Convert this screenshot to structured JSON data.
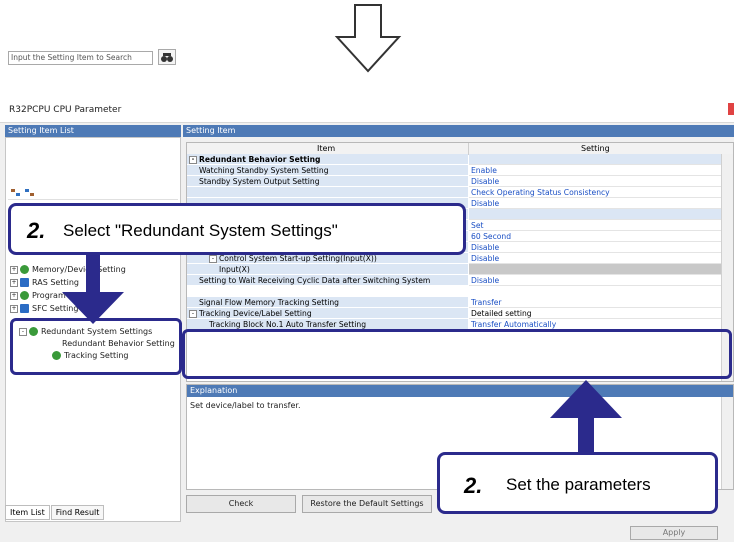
{
  "window": {
    "title": "R32PCPU CPU Parameter"
  },
  "left_panel": {
    "header": "Setting Item List",
    "search_placeholder": "Input the Setting Item to Search",
    "tree": [
      {
        "label": "Memory/Device Setting",
        "sign": "+"
      },
      {
        "label": "RAS Setting",
        "sign": "+"
      },
      {
        "label": "Program Setting",
        "sign": "+"
      },
      {
        "label": "SFC Setting",
        "sign": "+"
      },
      {
        "label": "Redundant System Settings",
        "sign": "-"
      },
      {
        "label": "Redundant Behavior Setting",
        "sign": ""
      },
      {
        "label": "Tracking Setting",
        "sign": ""
      }
    ],
    "tabs": [
      "Item List",
      "Find Result"
    ]
  },
  "setting_item": {
    "header": "Setting Item",
    "columns": {
      "item": "Item",
      "setting": "Setting"
    },
    "rows": [
      {
        "item": "Redundant Behavior Setting",
        "setting": "",
        "section": true,
        "sign": "-"
      },
      {
        "item": "Watching Standby System Setting",
        "setting": "Enable",
        "indent": 1
      },
      {
        "item": "Standby System Output Setting",
        "setting": "Disable",
        "indent": 1
      },
      {
        "item": "",
        "setting": "Check Operating Status Consistency",
        "indent": 1
      },
      {
        "item": "",
        "setting": "Disable",
        "indent": 1
      },
      {
        "item": "",
        "setting": "",
        "indent": 1,
        "blank": true
      },
      {
        "item": "",
        "setting": "Set",
        "indent": 1
      },
      {
        "item": "",
        "setting": "60 Second",
        "indent": 1
      },
      {
        "item": "Control System Start-up Setting(Switch Operation)",
        "setting": "Disable",
        "indent": 2
      },
      {
        "item": "Control System Start-up Setting(Input(X))",
        "setting": "Disable",
        "indent": 2,
        "sign": "-"
      },
      {
        "item": "Input(X)",
        "setting": "",
        "indent": 3,
        "gray": true
      },
      {
        "item": "Setting to Wait Receiving Cyclic Data after Switching System",
        "setting": "Disable",
        "indent": 1
      },
      {
        "item": "Signal Flow Memory Tracking Setting",
        "setting": "Transfer",
        "indent": 1
      },
      {
        "item": "Tracking Device/Label Setting",
        "setting": "Detailed setting",
        "indent": 0,
        "sign": "-",
        "black": true
      },
      {
        "item": "Tracking Block No.1 Auto Transfer Setting",
        "setting": "Transfer Automatically",
        "indent": 2
      }
    ]
  },
  "explanation": {
    "header": "Explanation",
    "text": "Set device/label to transfer."
  },
  "buttons": {
    "check": "Check",
    "restore": "Restore the Default Settings",
    "apply": "Apply"
  },
  "callouts": {
    "select": {
      "number": "2.",
      "text": "Select \"Redundant System Settings\""
    },
    "set": {
      "number": "2.",
      "text": "Set the parameters"
    }
  },
  "colors": {
    "accent": "#2b2a8c",
    "header": "#4e7ab6",
    "value_text": "#1a4fc4"
  }
}
